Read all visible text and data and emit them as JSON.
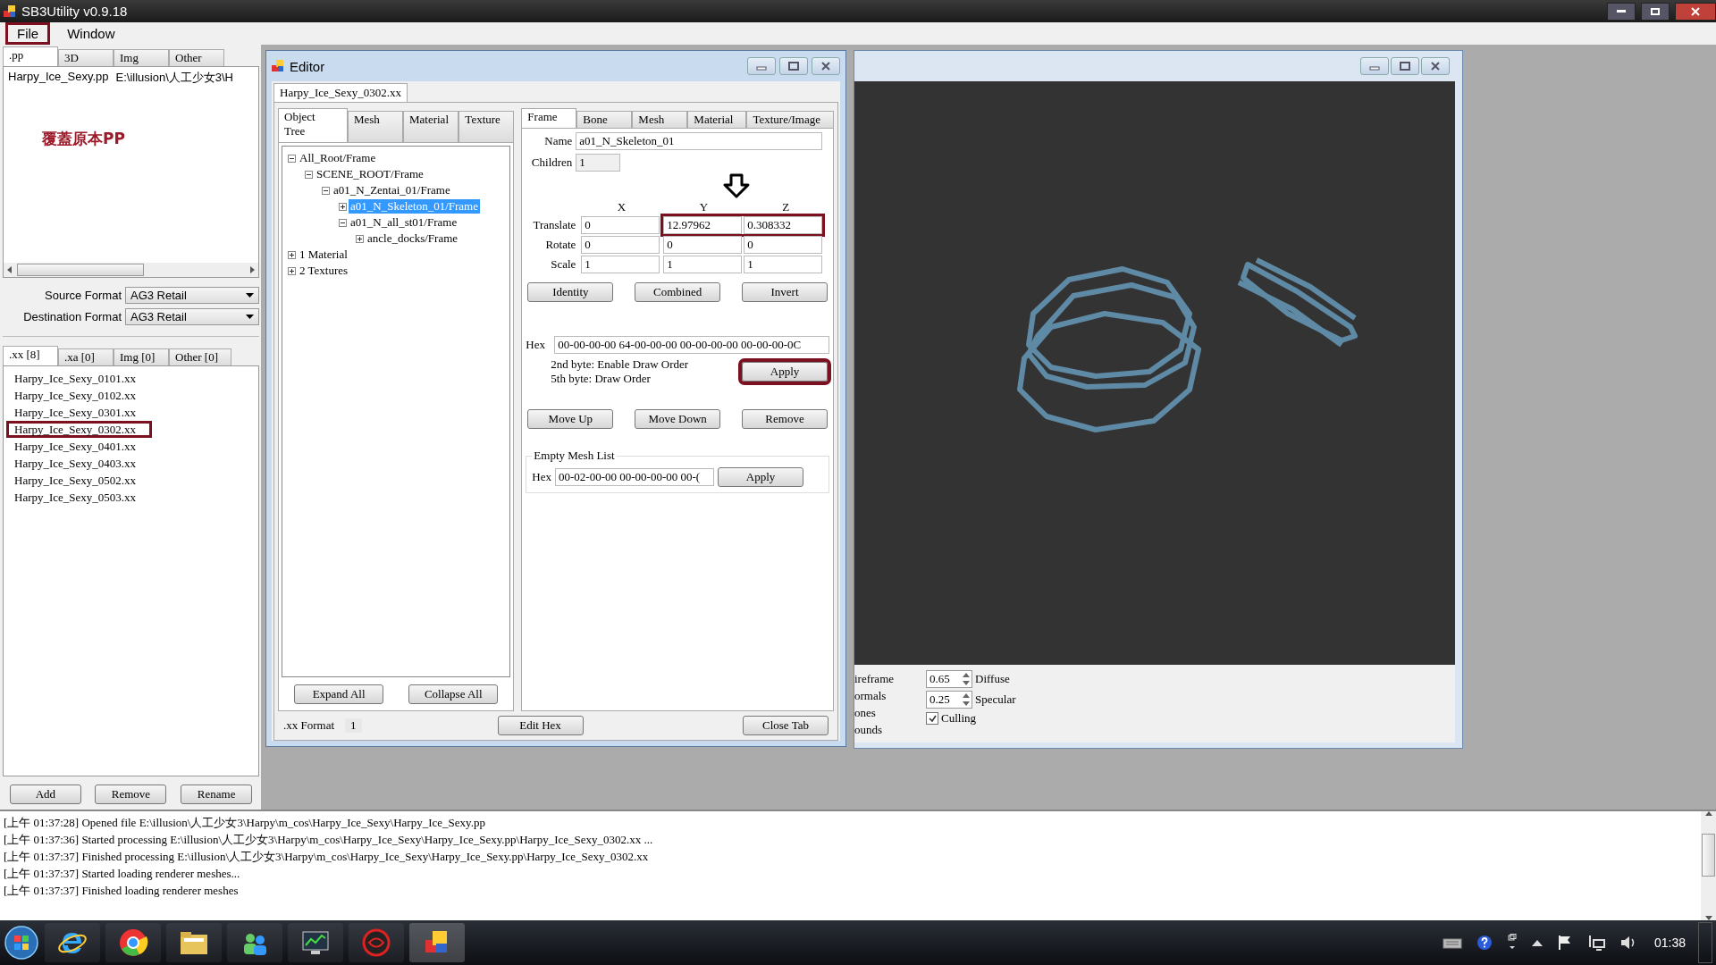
{
  "window": {
    "title": "SB3Utility v0.9.18"
  },
  "menu": [
    {
      "label": "File",
      "marked": true
    },
    {
      "label": "Window",
      "marked": false
    }
  ],
  "pp_panel": {
    "tabs": [
      {
        "label": ".pp",
        "selected": true
      },
      {
        "label": "3D",
        "selected": false
      },
      {
        "label": "Img",
        "selected": false
      },
      {
        "label": "Other",
        "selected": false
      }
    ],
    "files": [
      {
        "name": "Harpy_Ice_Sexy.pp",
        "path": "E:\\illusion\\人工少女3\\H"
      }
    ],
    "note": "覆蓋原本PP",
    "formats": [
      {
        "label": "Source Format",
        "value": "AG3 Retail"
      },
      {
        "label": "Destination Format",
        "value": "AG3 Retail"
      }
    ]
  },
  "xx_panel": {
    "tabs": [
      {
        "label": ".xx [8]",
        "selected": true
      },
      {
        "label": ".xa [0]",
        "selected": false
      },
      {
        "label": "Img [0]",
        "selected": false
      },
      {
        "label": "Other [0]",
        "selected": false
      }
    ],
    "files": [
      {
        "name": "Harpy_Ice_Sexy_0101.xx",
        "marked": false
      },
      {
        "name": "Harpy_Ice_Sexy_0102.xx",
        "marked": false
      },
      {
        "name": "Harpy_Ice_Sexy_0301.xx",
        "marked": false
      },
      {
        "name": "Harpy_Ice_Sexy_0302.xx",
        "marked": true
      },
      {
        "name": "Harpy_Ice_Sexy_0401.xx",
        "marked": false
      },
      {
        "name": "Harpy_Ice_Sexy_0403.xx",
        "marked": false
      },
      {
        "name": "Harpy_Ice_Sexy_0502.xx",
        "marked": false
      },
      {
        "name": "Harpy_Ice_Sexy_0503.xx",
        "marked": false
      }
    ],
    "buttons": [
      "Add",
      "Remove",
      "Rename"
    ]
  },
  "editor": {
    "title": "Editor",
    "document_tab": "Harpy_Ice_Sexy_0302.xx",
    "left_tabs": [
      {
        "label": "Object Tree",
        "selected": true
      },
      {
        "label": "Mesh",
        "selected": false
      },
      {
        "label": "Material",
        "selected": false
      },
      {
        "label": "Texture",
        "selected": false
      }
    ],
    "tree": [
      {
        "label": "All_Root/Frame",
        "expanded": true,
        "selected": false,
        "children": [
          {
            "label": "SCENE_ROOT/Frame",
            "expanded": true,
            "selected": false,
            "children": [
              {
                "label": "a01_N_Zentai_01/Frame",
                "expanded": true,
                "selected": false,
                "children": [
                  {
                    "label": "a01_N_Skeleton_01/Frame",
                    "expanded": false,
                    "selected": true
                  },
                  {
                    "label": "a01_N_all_st01/Frame",
                    "expanded": true,
                    "selected": false,
                    "children": [
                      {
                        "label": "ancle_docks/Frame",
                        "expanded": false,
                        "selected": false
                      }
                    ]
                  }
                ]
              }
            ]
          }
        ]
      },
      {
        "label": "1 Material",
        "expanded": false,
        "selected": false
      },
      {
        "label": "2 Textures",
        "expanded": false,
        "selected": false
      }
    ],
    "tree_buttons": [
      "Expand All",
      "Collapse All"
    ],
    "right_tabs": [
      {
        "label": "Frame",
        "selected": true
      },
      {
        "label": "Bone",
        "selected": false
      },
      {
        "label": "Mesh",
        "selected": false
      },
      {
        "label": "Material",
        "selected": false
      },
      {
        "label": "Texture/Image",
        "selected": false
      }
    ],
    "frame": {
      "name_label": "Name",
      "name": "a01_N_Skeleton_01",
      "children_label": "Children",
      "children": "1",
      "axes": [
        "X",
        "Y",
        "Z"
      ],
      "transform": [
        {
          "label": "Translate",
          "values": [
            "0",
            "12.97962",
            "0.308332"
          ],
          "marked": true
        },
        {
          "label": "Rotate",
          "values": [
            "0",
            "0",
            "0"
          ],
          "marked": false
        },
        {
          "label": "Scale",
          "values": [
            "1",
            "1",
            "1"
          ],
          "marked": false
        }
      ],
      "matrix_buttons": [
        "Identity",
        "Combined",
        "Invert"
      ],
      "hex_label": "Hex",
      "hex": "00-00-00-00 64-00-00-00 00-00-00-00 00-00-00-0C",
      "notes": [
        "2nd byte: Enable Draw Order",
        "5th byte: Draw Order"
      ],
      "apply": {
        "label": "Apply",
        "marked": true
      },
      "order_buttons": [
        "Move Up",
        "Move Down",
        "Remove"
      ],
      "empty_mesh": {
        "title": "Empty Mesh List",
        "hex_label": "Hex",
        "hex": "00-02-00-00 00-00-00-00 00-(",
        "apply": "Apply"
      }
    },
    "footer": {
      "format_label": ".xx Format",
      "format": "1",
      "buttons": [
        "Edit Hex",
        "Close Tab"
      ]
    }
  },
  "renderer": {
    "options": [
      "ireframe",
      "ormals",
      "ones",
      "ounds"
    ],
    "spinners": [
      {
        "value": "0.65",
        "label": "Diffuse"
      },
      {
        "value": "0.25",
        "label": "Specular"
      }
    ],
    "culling": {
      "label": "Culling",
      "checked": true
    }
  },
  "log": [
    "[上午 01:37:28] Opened file E:\\illusion\\人工少女3\\Harpy\\m_cos\\Harpy_Ice_Sexy\\Harpy_Ice_Sexy.pp",
    "[上午 01:37:36] Started processing E:\\illusion\\人工少女3\\Harpy\\m_cos\\Harpy_Ice_Sexy\\Harpy_Ice_Sexy.pp\\Harpy_Ice_Sexy_0302.xx ...",
    "[上午 01:37:37] Finished processing E:\\illusion\\人工少女3\\Harpy\\m_cos\\Harpy_Ice_Sexy\\Harpy_Ice_Sexy.pp\\Harpy_Ice_Sexy_0302.xx",
    "[上午 01:37:37] Started loading renderer meshes...",
    "[上午 01:37:37] Finished loading renderer meshes"
  ],
  "taskbar": {
    "clock": "01:38"
  }
}
